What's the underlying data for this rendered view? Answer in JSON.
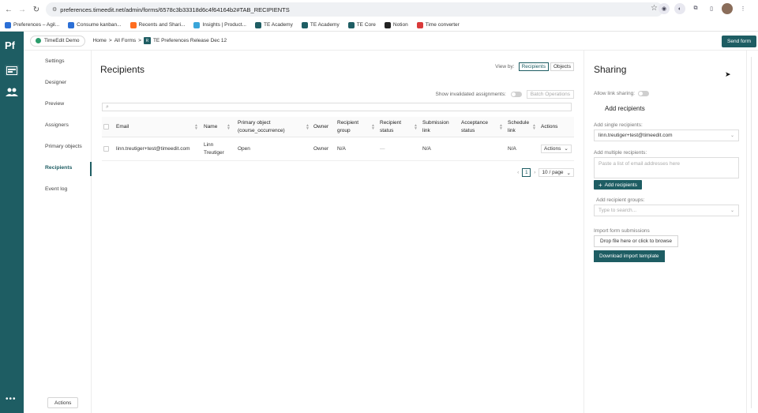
{
  "browser": {
    "url": "preferences.timeedit.net/admin/forms/6578c3b33318d6c4f64164b2#TAB_RECIPIENTS",
    "bookmarks": [
      {
        "label": "Preferences – Agil...",
        "color": "#2b6fd6"
      },
      {
        "label": "Consume kanban...",
        "color": "#2b6fd6"
      },
      {
        "label": "Recents and Shari...",
        "color": "#ff6d1f"
      },
      {
        "label": "Insights | Product...",
        "color": "#3aa5d9"
      },
      {
        "label": "TE Academy",
        "color": "#1e5d63"
      },
      {
        "label": "TE Academy",
        "color": "#1e5d63"
      },
      {
        "label": "TE Core",
        "color": "#1e5d63"
      },
      {
        "label": "Notion",
        "color": "#222222"
      },
      {
        "label": "Time converter",
        "color": "#d93a3a"
      }
    ]
  },
  "rail": {
    "logo": "Pf",
    "more": "•••"
  },
  "header": {
    "org": "TimeEdit Demo",
    "crumb_home": "Home",
    "crumb_forms": "All Forms",
    "crumb_badge": "R",
    "crumb_current": "TE Preferences Release Dec 12",
    "send_label": "Send form"
  },
  "menu": {
    "items": [
      "Settings",
      "Designer",
      "Preview",
      "Assigners",
      "Primary objects",
      "Recipients",
      "Event log"
    ],
    "active": "Recipients",
    "actions_label": "Actions"
  },
  "main": {
    "title": "Recipients",
    "view_by_label": "View by:",
    "view_options": [
      "Recipients",
      "Objects"
    ],
    "invalid_label": "Show invalidated assignments:",
    "batch_label": "Batch Operations",
    "columns": [
      "Email",
      "Name",
      "Primary object (course_occurrence)",
      "Owner",
      "Recipient group",
      "Recipient status",
      "Submission link",
      "Acceptance status",
      "Schedule link",
      "Actions"
    ],
    "rows": [
      {
        "email": "linn.treutiger+test@timeedit.com",
        "name": "Linn Treutiger",
        "primary_object": "Open",
        "owner": "Owner",
        "group": "N/A",
        "status": "—",
        "submission": "N/A",
        "acceptance": "",
        "schedule": "N/A",
        "actions": "Actions"
      }
    ],
    "pager": {
      "page": "1",
      "size": "10 / page"
    }
  },
  "sharing": {
    "title": "Sharing",
    "link_label": "Allow link sharing:",
    "add_recipients_heading": "Add recipients",
    "single_label": "Add single recipients:",
    "single_value": "linn.treutiger+test@timeedit.com",
    "multiple_label": "Add multiple recipients:",
    "multiple_placeholder": "Paste a list of email addresses here",
    "add_button": "Add recipients",
    "groups_label": "Add recipient groups:",
    "groups_placeholder": "Type to search...",
    "import_label": "Import form submissions",
    "drop_label": "Drop file here or click to browse",
    "download_label": "Download import template"
  }
}
